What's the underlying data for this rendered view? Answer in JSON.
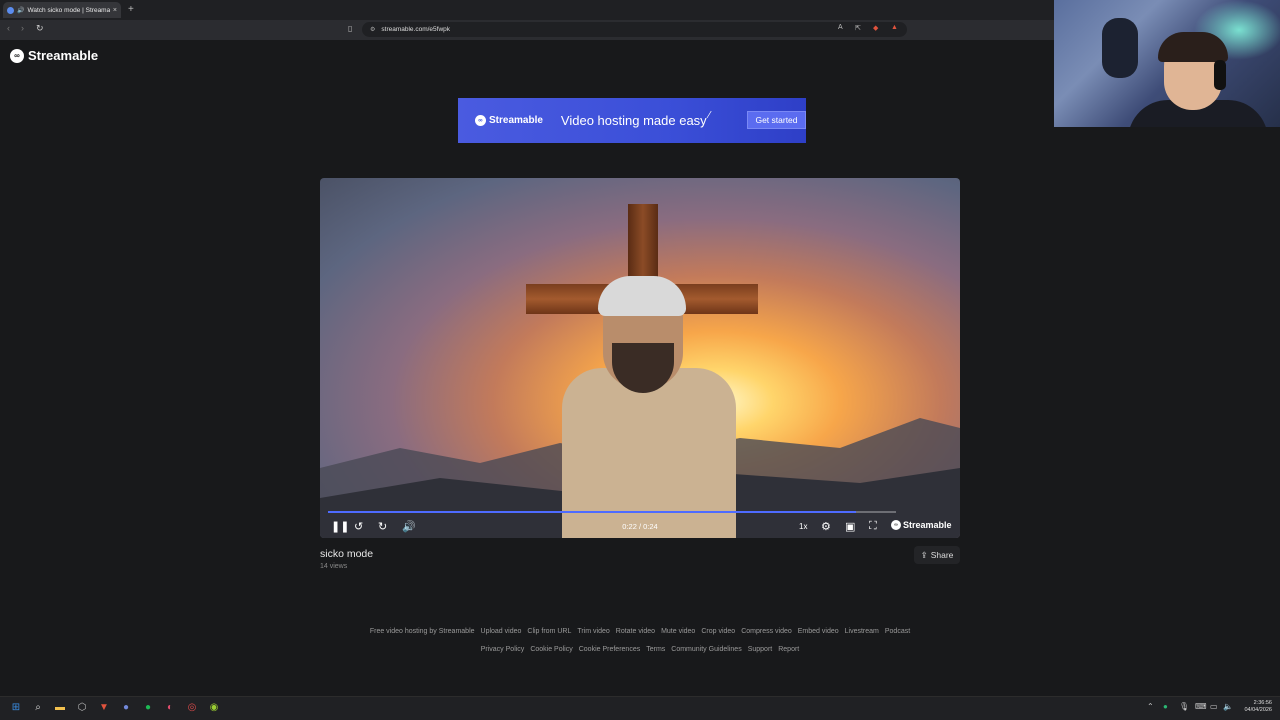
{
  "browser": {
    "tab_title": "Watch sicko mode | Streamable",
    "tab_close": "×",
    "new_tab": "+",
    "url": "streamable.com/e5fwpk"
  },
  "site": {
    "brand": "Streamable"
  },
  "banner": {
    "brand": "Streamable",
    "tagline": "Video hosting made easy",
    "cta": "Get started"
  },
  "player": {
    "time": "0:22 / 0:24",
    "progress": 0.93,
    "speed": "1x",
    "watermark": "Streamable"
  },
  "video": {
    "title": "sicko mode",
    "views": "14 views",
    "share_label": "Share"
  },
  "footer": {
    "row1": [
      "Free video hosting by Streamable",
      "Upload video",
      "Clip from URL",
      "Trim video",
      "Rotate video",
      "Mute video",
      "Crop video",
      "Compress video",
      "Embed video",
      "Livestream",
      "Podcast"
    ],
    "row2": [
      "Privacy Policy",
      "Cookie Policy",
      "Cookie Preferences",
      "Terms",
      "Community Guidelines",
      "Support",
      "Report"
    ]
  },
  "taskbar": {
    "time": "2:36:56",
    "date": "04/04/2026"
  },
  "colors": {
    "accent": "#4e6bff",
    "banner": "#3b4fd8",
    "page_bg": "#18191b"
  }
}
